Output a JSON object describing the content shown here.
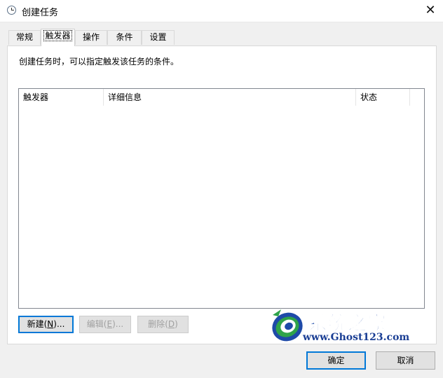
{
  "window": {
    "title": "创建任务",
    "close_glyph": "✕"
  },
  "tabs": [
    {
      "label": "常规",
      "active": false
    },
    {
      "label": "触发器",
      "active": true
    },
    {
      "label": "操作",
      "active": false
    },
    {
      "label": "条件",
      "active": false
    },
    {
      "label": "设置",
      "active": false
    }
  ],
  "triggers_tab": {
    "description": "创建任务时，可以指定触发该任务的条件。",
    "columns": [
      "触发器",
      "详细信息",
      "状态"
    ],
    "rows": [],
    "buttons": {
      "new": {
        "label": "新建",
        "accel": "N",
        "suffix": "..."
      },
      "edit": {
        "label": "编辑",
        "accel": "E",
        "suffix": "...",
        "disabled": true
      },
      "delete": {
        "label": "删除",
        "accel": "D",
        "suffix": "",
        "disabled": true
      }
    }
  },
  "footer": {
    "ok_label": "确定",
    "cancel_label": "取消"
  },
  "watermark": {
    "title": "系统之家",
    "url": "www.Ghost123.com"
  },
  "colors": {
    "accent": "#0078d7",
    "watermark_blue": "#1e4aa8",
    "watermark_green": "#2fa34a"
  },
  "icons": {
    "title": "clock-icon",
    "close": "close-icon",
    "watermark": "system-home-logo-icon"
  }
}
